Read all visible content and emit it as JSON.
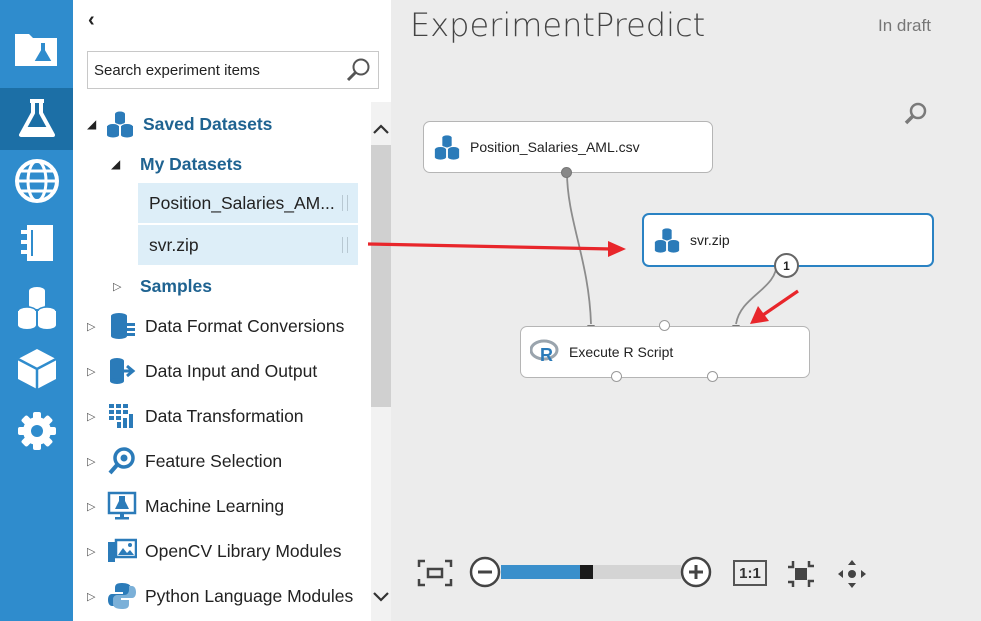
{
  "rail": {
    "items": [
      {
        "icon": "projects-icon",
        "active": false
      },
      {
        "icon": "experiments-icon",
        "active": true
      },
      {
        "icon": "web-services-icon",
        "active": false
      },
      {
        "icon": "notebooks-icon",
        "active": false
      },
      {
        "icon": "datasets-icon",
        "active": false
      },
      {
        "icon": "trained-models-icon",
        "active": false
      },
      {
        "icon": "settings-icon",
        "active": false
      }
    ]
  },
  "palette": {
    "collapse_glyph": "‹",
    "search_placeholder": "Search experiment items",
    "saved_datasets": "Saved Datasets",
    "my_datasets": "My Datasets",
    "dataset_items": [
      "Position_Salaries_AM...",
      "svr.zip"
    ],
    "samples": "Samples",
    "categories": [
      {
        "label": "Data Format Conversions",
        "icon": "data-format-icon"
      },
      {
        "label": "Data Input and Output",
        "icon": "data-input-output-icon"
      },
      {
        "label": "Data Transformation",
        "icon": "data-transformation-icon"
      },
      {
        "label": "Feature Selection",
        "icon": "feature-selection-icon"
      },
      {
        "label": "Machine Learning",
        "icon": "machine-learning-icon"
      },
      {
        "label": "OpenCV Library Modules",
        "icon": "opencv-icon"
      },
      {
        "label": "Python Language Modules",
        "icon": "python-icon"
      }
    ]
  },
  "canvas": {
    "title": "ExperimentPredict",
    "status": "In draft",
    "nodes": {
      "csv": "Position_Salaries_AML.csv",
      "svr": "svr.zip",
      "rscript": "Execute R Script"
    },
    "badge_number": "1",
    "toolbar": {
      "one_to_one": "1:1",
      "zoom_level_fraction": 0.44
    }
  },
  "colors": {
    "rail": "#2f8ccd",
    "rail_active": "#1c6fa6",
    "selection": "#ddeef8",
    "accent_text": "#1f6391",
    "canvas_bg": "#ececec",
    "annotation_arrow": "#e8262b",
    "selected_node_border": "#2a82c3"
  }
}
